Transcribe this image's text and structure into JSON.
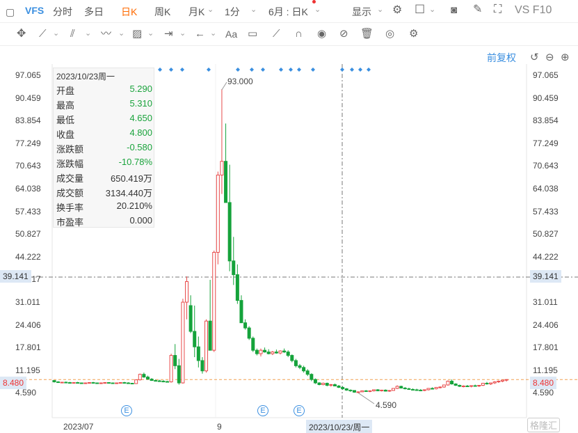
{
  "toolbar": {
    "symbol": "VFS",
    "periods": [
      "分时",
      "多日",
      "日K",
      "周K",
      "月K",
      "1分"
    ],
    "selected_period": "日K",
    "range_select": "6月 : 日K",
    "display_label": "显示",
    "brand": "VS F10"
  },
  "fuquan_label": "前复权",
  "price_axis": [
    "97.065",
    "90.459",
    "83.854",
    "77.249",
    "70.643",
    "64.038",
    "57.433",
    "50.827",
    "44.222",
    "37.617",
    "31.011",
    "24.406",
    "17.801",
    "11.195",
    "4.590"
  ],
  "crosshair": {
    "price_tag": "39.141",
    "date_tag": "2023/10/23/周一"
  },
  "last_price_tag": "8.480",
  "annotations": {
    "high_label": "93.000",
    "low_label": "4.590"
  },
  "x_axis": [
    "2023/07",
    "9"
  ],
  "event_marker": "E",
  "info_panel": {
    "date": "2023/10/23周一",
    "rows": [
      {
        "k": "开盘",
        "v": "5.290"
      },
      {
        "k": "最高",
        "v": "5.310"
      },
      {
        "k": "最低",
        "v": "4.650"
      },
      {
        "k": "收盘",
        "v": "4.800"
      },
      {
        "k": "涨跌额",
        "v": "-0.580"
      },
      {
        "k": "涨跌幅",
        "v": "-10.78%"
      },
      {
        "k": "成交量",
        "v": "650.419万"
      },
      {
        "k": "成交额",
        "v": "3134.440万"
      },
      {
        "k": "换手率",
        "v": "20.210%"
      },
      {
        "k": "市盈率",
        "v": "0.000"
      }
    ]
  },
  "watermark": "格隆汇",
  "colors": {
    "up": "#e84a4a",
    "down": "#15a33b",
    "accent": "#ff6a00",
    "dashed_last": "#f0a050"
  },
  "chart_data": {
    "type": "candlestick",
    "ylim": [
      1.288,
      100.367
    ],
    "x_range": [
      "2023/07",
      "2024/01"
    ],
    "candles": [
      [
        8.2,
        8.3,
        7.6,
        7.8
      ],
      [
        7.8,
        8.0,
        7.5,
        7.6
      ],
      [
        7.6,
        7.8,
        7.4,
        7.7
      ],
      [
        7.7,
        7.9,
        7.5,
        7.6
      ],
      [
        7.6,
        7.8,
        7.4,
        7.5
      ],
      [
        7.5,
        7.7,
        7.3,
        7.6
      ],
      [
        7.6,
        7.8,
        7.4,
        7.5
      ],
      [
        7.5,
        7.6,
        7.3,
        7.4
      ],
      [
        7.4,
        7.6,
        7.2,
        7.5
      ],
      [
        7.5,
        7.7,
        7.3,
        7.6
      ],
      [
        7.6,
        7.8,
        7.4,
        7.5
      ],
      [
        7.5,
        7.6,
        7.3,
        7.4
      ],
      [
        7.4,
        7.6,
        7.2,
        7.5
      ],
      [
        7.5,
        7.7,
        7.3,
        7.6
      ],
      [
        7.6,
        7.7,
        7.4,
        7.5
      ],
      [
        7.5,
        7.6,
        7.3,
        7.4
      ],
      [
        7.4,
        7.6,
        7.2,
        7.5
      ],
      [
        7.5,
        7.7,
        7.3,
        7.6
      ],
      [
        7.6,
        7.8,
        7.4,
        7.5
      ],
      [
        7.5,
        7.7,
        7.3,
        7.4
      ],
      [
        7.4,
        7.5,
        7.2,
        7.3
      ],
      [
        7.3,
        8.5,
        7.2,
        8.4
      ],
      [
        8.4,
        10.2,
        8.2,
        10.0
      ],
      [
        10.0,
        10.5,
        9.0,
        9.2
      ],
      [
        9.2,
        9.6,
        8.4,
        8.6
      ],
      [
        8.6,
        8.9,
        8.1,
        8.2
      ],
      [
        8.2,
        8.5,
        7.9,
        8.1
      ],
      [
        8.1,
        8.4,
        7.8,
        8.0
      ],
      [
        8.0,
        8.3,
        7.7,
        7.9
      ],
      [
        7.9,
        8.1,
        7.6,
        7.8
      ],
      [
        7.8,
        16.0,
        7.6,
        15.5
      ],
      [
        15.5,
        18.8,
        11.5,
        12.5
      ],
      [
        12.5,
        14.5,
        7.0,
        7.5
      ],
      [
        7.5,
        32.0,
        7.3,
        31.0
      ],
      [
        31.0,
        38.5,
        26.0,
        37.0
      ],
      [
        30.0,
        33.0,
        22.0,
        22.5
      ],
      [
        22.5,
        30.0,
        15.0,
        18.0
      ],
      [
        18.0,
        21.0,
        12.0,
        14.0
      ],
      [
        14.0,
        15.0,
        10.2,
        11.0
      ],
      [
        11.0,
        26.0,
        10.5,
        25.5
      ],
      [
        25.5,
        37.5,
        17.0,
        17.0
      ],
      [
        17.0,
        46.0,
        16.5,
        45.5
      ],
      [
        45.5,
        69.0,
        42.0,
        68.0
      ],
      [
        68.0,
        93.0,
        62.5,
        72.0
      ],
      [
        72.0,
        83.0,
        62.0,
        60.0
      ],
      [
        60.0,
        71.0,
        40.0,
        43.0
      ],
      [
        43.0,
        50.0,
        36.0,
        39.0
      ],
      [
        39.0,
        42.0,
        30.5,
        31.5
      ],
      [
        31.5,
        33.0,
        25.0,
        25.0
      ],
      [
        25.0,
        26.0,
        23.0,
        23.5
      ],
      [
        23.5,
        24.0,
        20.0,
        20.5
      ],
      [
        20.5,
        21.0,
        16.5,
        17.0
      ],
      [
        17.0,
        17.5,
        15.5,
        16.0
      ],
      [
        16.0,
        17.5,
        15.2,
        17.0
      ],
      [
        17.0,
        17.8,
        16.3,
        16.5
      ],
      [
        16.5,
        17.3,
        15.8,
        16.0
      ],
      [
        16.0,
        16.8,
        15.6,
        16.5
      ],
      [
        16.5,
        17.2,
        16.0,
        16.2
      ],
      [
        16.2,
        17.0,
        15.8,
        16.8
      ],
      [
        16.8,
        17.5,
        16.2,
        16.5
      ],
      [
        16.5,
        17.0,
        15.0,
        15.5
      ],
      [
        15.5,
        15.8,
        13.5,
        14.0
      ],
      [
        14.0,
        14.5,
        12.0,
        12.5
      ],
      [
        12.5,
        13.0,
        11.5,
        12.0
      ],
      [
        12.0,
        12.5,
        10.5,
        11.0
      ],
      [
        11.0,
        11.5,
        9.5,
        10.0
      ],
      [
        10.0,
        10.3,
        8.0,
        8.5
      ],
      [
        8.5,
        8.8,
        7.2,
        7.5
      ],
      [
        7.5,
        7.7,
        6.8,
        7.0
      ],
      [
        7.0,
        7.6,
        6.8,
        7.4
      ],
      [
        7.4,
        7.6,
        6.5,
        6.8
      ],
      [
        6.8,
        7.2,
        6.4,
        7.0
      ],
      [
        7.0,
        7.3,
        6.5,
        6.6
      ],
      [
        6.6,
        6.9,
        6.0,
        6.2
      ],
      [
        6.2,
        6.5,
        5.5,
        5.8
      ],
      [
        5.8,
        6.0,
        5.2,
        5.4
      ],
      [
        5.4,
        5.6,
        4.9,
        5.2
      ],
      [
        5.3,
        5.31,
        4.65,
        4.8
      ],
      [
        4.8,
        5.0,
        4.59,
        4.9
      ],
      [
        4.9,
        5.3,
        4.8,
        5.2
      ],
      [
        5.2,
        5.4,
        4.9,
        5.0
      ],
      [
        5.0,
        5.3,
        4.8,
        5.2
      ],
      [
        5.2,
        5.6,
        5.0,
        5.5
      ],
      [
        5.5,
        5.7,
        5.1,
        5.2
      ],
      [
        5.2,
        5.5,
        5.0,
        5.4
      ],
      [
        5.4,
        5.6,
        5.0,
        5.1
      ],
      [
        5.1,
        5.4,
        4.9,
        5.3
      ],
      [
        5.3,
        6.0,
        5.2,
        5.9
      ],
      [
        5.9,
        6.8,
        5.7,
        6.5
      ],
      [
        6.5,
        6.7,
        5.9,
        6.0
      ],
      [
        6.0,
        6.3,
        5.6,
        5.8
      ],
      [
        5.8,
        6.1,
        5.5,
        5.6
      ],
      [
        5.6,
        5.9,
        5.3,
        5.5
      ],
      [
        5.5,
        5.8,
        5.2,
        5.4
      ],
      [
        5.4,
        5.7,
        5.1,
        5.3
      ],
      [
        5.3,
        5.6,
        5.1,
        5.5
      ],
      [
        5.5,
        6.0,
        5.3,
        5.9
      ],
      [
        5.9,
        6.2,
        5.6,
        5.8
      ],
      [
        5.8,
        6.3,
        5.6,
        6.2
      ],
      [
        6.2,
        6.5,
        5.9,
        6.3
      ],
      [
        6.3,
        7.0,
        6.1,
        6.9
      ],
      [
        6.9,
        8.2,
        6.7,
        8.0
      ],
      [
        8.0,
        8.5,
        7.0,
        7.2
      ],
      [
        7.2,
        7.4,
        6.6,
        6.8
      ],
      [
        6.8,
        7.0,
        6.3,
        6.5
      ],
      [
        6.5,
        6.8,
        6.2,
        6.6
      ],
      [
        6.6,
        6.9,
        6.3,
        6.5
      ],
      [
        6.5,
        6.8,
        6.2,
        6.7
      ],
      [
        6.7,
        7.0,
        6.4,
        6.6
      ],
      [
        6.6,
        6.9,
        6.3,
        6.8
      ],
      [
        6.8,
        7.5,
        6.6,
        7.4
      ],
      [
        7.4,
        7.8,
        7.0,
        7.2
      ],
      [
        7.2,
        7.6,
        6.9,
        7.5
      ],
      [
        7.5,
        8.0,
        7.2,
        7.8
      ],
      [
        7.8,
        8.2,
        7.5,
        8.0
      ],
      [
        8.0,
        8.4,
        7.7,
        8.3
      ],
      [
        8.3,
        8.5,
        7.9,
        8.48
      ]
    ]
  }
}
